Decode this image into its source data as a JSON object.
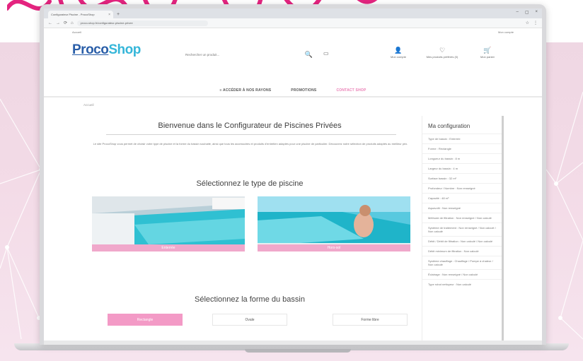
{
  "tab": {
    "title": "Configurateur Piscine - ProcoShop",
    "close": "×",
    "new": "+"
  },
  "window_controls": [
    "–",
    "▢",
    "×"
  ],
  "address": {
    "url": "proco-shop.fr/configurateur-piscine-privee",
    "back": "←",
    "forward": "→",
    "reload": "⟳",
    "home": "⌂",
    "star": "☆",
    "menu": "⋮"
  },
  "topstrip": {
    "left": "Accueil",
    "right": "Mon compte"
  },
  "logo": {
    "part1": "Proco",
    "part2": "Shop"
  },
  "search": {
    "placeholder": "Rechercher un produit...",
    "icon": "search-icon",
    "icon_glyph": "🔍"
  },
  "header_actions": [
    {
      "label": "Mon compte",
      "icon": "user-icon",
      "glyph": "👤"
    },
    {
      "label": "Mes produits préférés (0)",
      "icon": "heart-icon",
      "glyph": "♡"
    },
    {
      "label": "Mon panier",
      "icon": "cart-icon",
      "glyph": "🛒"
    }
  ],
  "cart_mini_glyph": "▭",
  "nav": [
    {
      "label": "≡ ACCÉDER À NOS RAYONS",
      "active": false
    },
    {
      "label": "PROMOTIONS",
      "active": false
    },
    {
      "label": "CONTACT SHOP",
      "active": true
    }
  ],
  "breadcrumb": "Accueil",
  "main": {
    "title": "Bienvenue dans le Configurateur de Piscines Privées",
    "intro": "Le site ProcoShop vous permet de choisir votre type de piscine et la forme du bassin souhaité, ainsi que tous les accessoires et produits d'entretien adaptés pour une piscine de particulier. Découvrez notre sélection de produits adaptés au meilleur prix.",
    "section_type": "Sélectionnez le type de piscine",
    "pool_types": [
      {
        "label": "Enterrée"
      },
      {
        "label": "Hors-sol"
      }
    ],
    "section_shape": "Sélectionnez la forme du bassin",
    "shapes": [
      {
        "label": "Rectangle",
        "selected": true
      },
      {
        "label": "Ovale",
        "selected": false
      },
      {
        "label": "Forme libre",
        "selected": false
      }
    ]
  },
  "sidebar": {
    "title": "Ma configuration",
    "items": [
      "Type de bassin : Enterrée",
      "Forme : Rectangle",
      "Longueur du bassin : 8 m",
      "Largeur du bassin : 4 m",
      "Surface bassin : 32 m²",
      "Profondeur / Nombre : Non renseigné",
      "Capacité : 48 m³",
      "Aquavoltt : Non renseigné",
      "Méthode de filtration : Non renseigné / Non calculé",
      "Système de traitement : Non renseigné / Non calculé / Non calculé",
      "Débit / Débit de filtration : Non calculé / Non calculé",
      "Débit minimum de filtration : Non calculé",
      "Système chauffage : Chauffage / Pompe à chaleur / Non calculé",
      "Éclairage : Non renseigné / Non calculé",
      "Type robot nettoyeur : Non calculé"
    ]
  },
  "colors": {
    "accent_pink": "#f39ac6",
    "logo_blue": "#2a5ea8",
    "logo_cyan": "#35b6d9",
    "bg_pink": "#f3dbe7"
  }
}
